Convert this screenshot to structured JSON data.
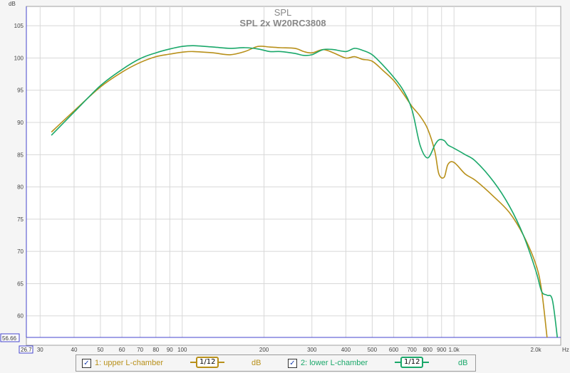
{
  "chart_data": {
    "type": "line",
    "title": "SPL",
    "subtitle": "SPL 2x W20RC3808",
    "ylabel": "dB",
    "xlabel": "Hz",
    "x_scale": "log",
    "xlim": [
      26.7,
      2470
    ],
    "ylim": [
      56.66,
      108
    ],
    "grid": true,
    "cursor_y": "56.66",
    "cursor_x": "26.7",
    "y_ticks": [
      60,
      65,
      70,
      75,
      80,
      85,
      90,
      95,
      100,
      105
    ],
    "x_ticks": [
      {
        "v": 30,
        "label": "30"
      },
      {
        "v": 40,
        "label": "40"
      },
      {
        "v": 50,
        "label": "50"
      },
      {
        "v": 60,
        "label": "60"
      },
      {
        "v": 70,
        "label": "70"
      },
      {
        "v": 80,
        "label": "80"
      },
      {
        "v": 90,
        "label": "90"
      },
      {
        "v": 100,
        "label": "100"
      },
      {
        "v": 200,
        "label": "200"
      },
      {
        "v": 300,
        "label": "300"
      },
      {
        "v": 400,
        "label": "400"
      },
      {
        "v": 500,
        "label": "500"
      },
      {
        "v": 600,
        "label": "600"
      },
      {
        "v": 700,
        "label": "700"
      },
      {
        "v": 800,
        "label": "800"
      },
      {
        "v": 900,
        "label": "900"
      },
      {
        "v": 1000,
        "label": "1.0k"
      },
      {
        "v": 2000,
        "label": "2.0k"
      }
    ],
    "series": [
      {
        "name": "1: upper L-chamber",
        "color": "#b8901a",
        "x": [
          33,
          40,
          50,
          60,
          70,
          80,
          90,
          100,
          110,
          130,
          150,
          170,
          190,
          210,
          230,
          260,
          280,
          300,
          330,
          360,
          400,
          430,
          460,
          500,
          550,
          600,
          650,
          700,
          750,
          800,
          850,
          880,
          920,
          950,
          1000,
          1100,
          1200,
          1400,
          1600,
          1800,
          2000,
          2100,
          2200
        ],
        "y": [
          88.5,
          91.8,
          95.5,
          97.8,
          99.3,
          100.2,
          100.6,
          100.9,
          101.0,
          100.8,
          100.5,
          101.0,
          101.8,
          101.7,
          101.6,
          101.5,
          101.0,
          100.8,
          101.3,
          100.8,
          100.0,
          100.2,
          99.8,
          99.5,
          98.0,
          96.5,
          94.5,
          92.5,
          91.0,
          89.0,
          85.5,
          82.0,
          81.5,
          83.5,
          83.8,
          82.0,
          81.0,
          78.5,
          76.0,
          72.5,
          68.0,
          64.0,
          56.66
        ]
      },
      {
        "name": "2: lower L-chamber",
        "color": "#1aa86a",
        "x": [
          33,
          40,
          50,
          60,
          70,
          80,
          90,
          100,
          110,
          130,
          150,
          170,
          190,
          210,
          230,
          260,
          280,
          300,
          330,
          360,
          400,
          430,
          460,
          500,
          550,
          600,
          650,
          700,
          750,
          800,
          850,
          880,
          920,
          950,
          1000,
          1100,
          1200,
          1400,
          1600,
          1800,
          2000,
          2100,
          2200,
          2300,
          2400
        ],
        "y": [
          88.0,
          91.6,
          95.7,
          98.2,
          99.9,
          100.8,
          101.4,
          101.8,
          101.9,
          101.7,
          101.5,
          101.6,
          101.4,
          101.0,
          101.0,
          100.7,
          100.4,
          100.5,
          101.3,
          101.3,
          101.0,
          101.5,
          101.2,
          100.5,
          98.8,
          97.0,
          95.0,
          92.0,
          86.5,
          84.5,
          86.5,
          87.3,
          87.2,
          86.5,
          86.0,
          85.0,
          84.0,
          80.8,
          77.0,
          72.5,
          67.0,
          63.8,
          63.2,
          62.5,
          56.66
        ]
      }
    ]
  },
  "legend": {
    "items": [
      {
        "label": "1: upper L-chamber",
        "smoothing": "1/12",
        "unit": "dB",
        "color": "#b8901a"
      },
      {
        "label": "2: lower L-chamber",
        "smoothing": "1/12",
        "unit": "dB",
        "color": "#1aa86a"
      }
    ]
  }
}
